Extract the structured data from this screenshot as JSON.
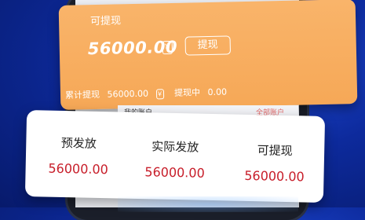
{
  "withdrawable_card": {
    "title": "可提现",
    "amount": "56000.00",
    "amount_icon": "￥",
    "withdraw_button": "提现",
    "cumulative_label": "累计提现",
    "cumulative_value": "56000.00",
    "pending_label": "提现中",
    "pending_value": "0.00",
    "yuan_icon": "￥"
  },
  "account_strip": {
    "left_label": "我的账户",
    "right_label": "全部账户"
  },
  "stats_card": {
    "items": [
      {
        "label": "预发放",
        "value": "56000.00"
      },
      {
        "label": "实际发放",
        "value": "56000.00"
      },
      {
        "label": "可提现",
        "value": "56000.00"
      }
    ]
  },
  "colors": {
    "orange": "#f6a857",
    "value_red": "#c8202c",
    "background_blue": "#0d2a9c"
  }
}
